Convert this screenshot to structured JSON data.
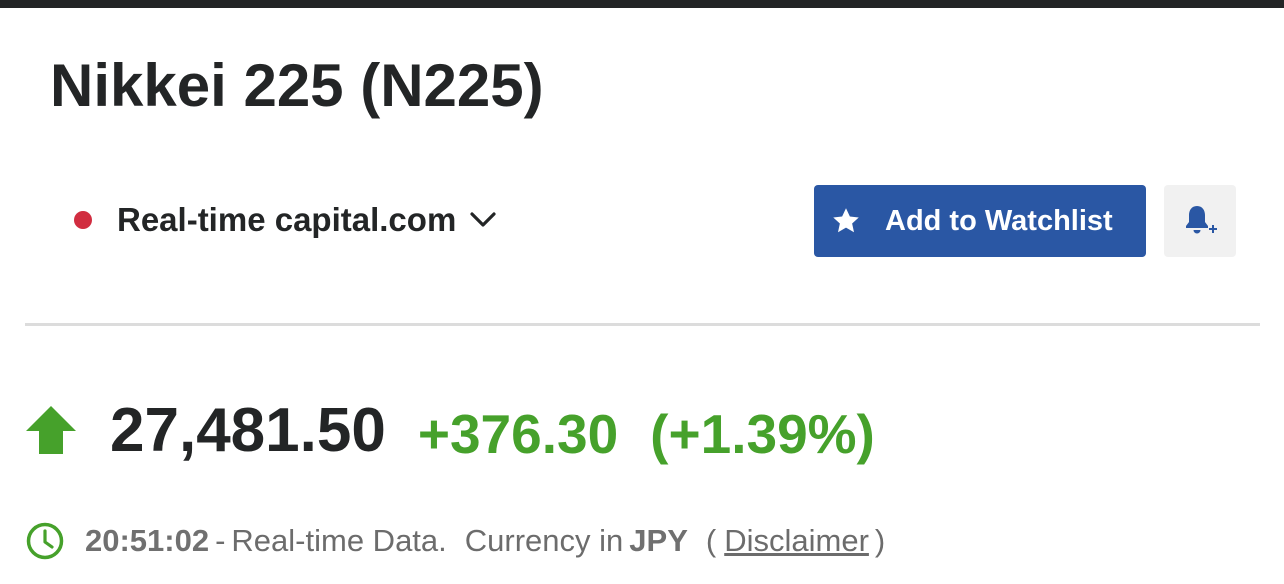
{
  "header": {
    "title": "Nikkei 225 (N225)"
  },
  "source": {
    "status_color": "#d12d40",
    "label": "Real-time capital.com",
    "dropdown_icon": "chevron-down-icon"
  },
  "actions": {
    "watchlist_label": "Add to Watchlist",
    "watchlist_icon": "star-icon",
    "alert_icon": "bell-plus-icon",
    "accent_color": "#2a57a4"
  },
  "quote": {
    "direction_icon": "arrow-up-icon",
    "price": "27,481.50",
    "change": "+376.30",
    "change_pct": "(+1.39%)",
    "positive_color": "#46a12b"
  },
  "meta": {
    "clock_icon": "clock-icon",
    "time": "20:51:02",
    "separator": "-",
    "data_type": "Real-time Data.",
    "currency_label": "Currency in",
    "currency": "JPY",
    "open_paren": "(",
    "disclaimer_label": "Disclaimer",
    "close_paren": ")"
  }
}
